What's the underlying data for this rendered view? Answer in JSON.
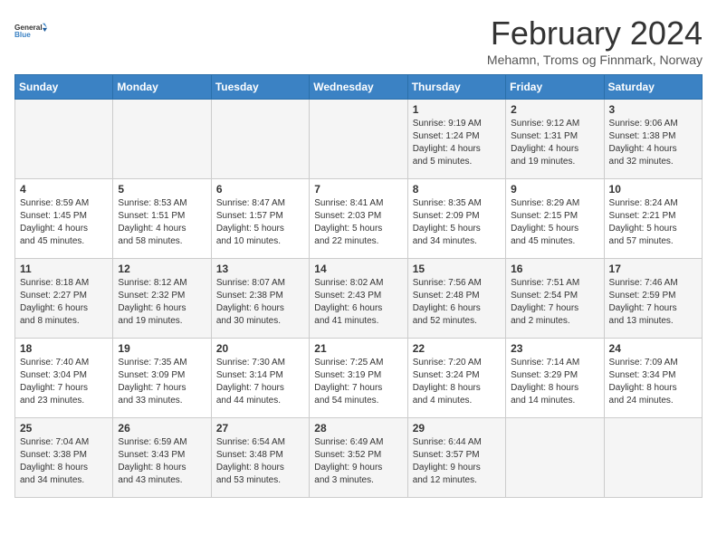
{
  "logo": {
    "line1": "General",
    "line2": "Blue"
  },
  "title": "February 2024",
  "subtitle": "Mehamn, Troms og Finnmark, Norway",
  "days_header": [
    "Sunday",
    "Monday",
    "Tuesday",
    "Wednesday",
    "Thursday",
    "Friday",
    "Saturday"
  ],
  "weeks": [
    [
      {
        "day": "",
        "info": ""
      },
      {
        "day": "",
        "info": ""
      },
      {
        "day": "",
        "info": ""
      },
      {
        "day": "",
        "info": ""
      },
      {
        "day": "1",
        "info": "Sunrise: 9:19 AM\nSunset: 1:24 PM\nDaylight: 4 hours\nand 5 minutes."
      },
      {
        "day": "2",
        "info": "Sunrise: 9:12 AM\nSunset: 1:31 PM\nDaylight: 4 hours\nand 19 minutes."
      },
      {
        "day": "3",
        "info": "Sunrise: 9:06 AM\nSunset: 1:38 PM\nDaylight: 4 hours\nand 32 minutes."
      }
    ],
    [
      {
        "day": "4",
        "info": "Sunrise: 8:59 AM\nSunset: 1:45 PM\nDaylight: 4 hours\nand 45 minutes."
      },
      {
        "day": "5",
        "info": "Sunrise: 8:53 AM\nSunset: 1:51 PM\nDaylight: 4 hours\nand 58 minutes."
      },
      {
        "day": "6",
        "info": "Sunrise: 8:47 AM\nSunset: 1:57 PM\nDaylight: 5 hours\nand 10 minutes."
      },
      {
        "day": "7",
        "info": "Sunrise: 8:41 AM\nSunset: 2:03 PM\nDaylight: 5 hours\nand 22 minutes."
      },
      {
        "day": "8",
        "info": "Sunrise: 8:35 AM\nSunset: 2:09 PM\nDaylight: 5 hours\nand 34 minutes."
      },
      {
        "day": "9",
        "info": "Sunrise: 8:29 AM\nSunset: 2:15 PM\nDaylight: 5 hours\nand 45 minutes."
      },
      {
        "day": "10",
        "info": "Sunrise: 8:24 AM\nSunset: 2:21 PM\nDaylight: 5 hours\nand 57 minutes."
      }
    ],
    [
      {
        "day": "11",
        "info": "Sunrise: 8:18 AM\nSunset: 2:27 PM\nDaylight: 6 hours\nand 8 minutes."
      },
      {
        "day": "12",
        "info": "Sunrise: 8:12 AM\nSunset: 2:32 PM\nDaylight: 6 hours\nand 19 minutes."
      },
      {
        "day": "13",
        "info": "Sunrise: 8:07 AM\nSunset: 2:38 PM\nDaylight: 6 hours\nand 30 minutes."
      },
      {
        "day": "14",
        "info": "Sunrise: 8:02 AM\nSunset: 2:43 PM\nDaylight: 6 hours\nand 41 minutes."
      },
      {
        "day": "15",
        "info": "Sunrise: 7:56 AM\nSunset: 2:48 PM\nDaylight: 6 hours\nand 52 minutes."
      },
      {
        "day": "16",
        "info": "Sunrise: 7:51 AM\nSunset: 2:54 PM\nDaylight: 7 hours\nand 2 minutes."
      },
      {
        "day": "17",
        "info": "Sunrise: 7:46 AM\nSunset: 2:59 PM\nDaylight: 7 hours\nand 13 minutes."
      }
    ],
    [
      {
        "day": "18",
        "info": "Sunrise: 7:40 AM\nSunset: 3:04 PM\nDaylight: 7 hours\nand 23 minutes."
      },
      {
        "day": "19",
        "info": "Sunrise: 7:35 AM\nSunset: 3:09 PM\nDaylight: 7 hours\nand 33 minutes."
      },
      {
        "day": "20",
        "info": "Sunrise: 7:30 AM\nSunset: 3:14 PM\nDaylight: 7 hours\nand 44 minutes."
      },
      {
        "day": "21",
        "info": "Sunrise: 7:25 AM\nSunset: 3:19 PM\nDaylight: 7 hours\nand 54 minutes."
      },
      {
        "day": "22",
        "info": "Sunrise: 7:20 AM\nSunset: 3:24 PM\nDaylight: 8 hours\nand 4 minutes."
      },
      {
        "day": "23",
        "info": "Sunrise: 7:14 AM\nSunset: 3:29 PM\nDaylight: 8 hours\nand 14 minutes."
      },
      {
        "day": "24",
        "info": "Sunrise: 7:09 AM\nSunset: 3:34 PM\nDaylight: 8 hours\nand 24 minutes."
      }
    ],
    [
      {
        "day": "25",
        "info": "Sunrise: 7:04 AM\nSunset: 3:38 PM\nDaylight: 8 hours\nand 34 minutes."
      },
      {
        "day": "26",
        "info": "Sunrise: 6:59 AM\nSunset: 3:43 PM\nDaylight: 8 hours\nand 43 minutes."
      },
      {
        "day": "27",
        "info": "Sunrise: 6:54 AM\nSunset: 3:48 PM\nDaylight: 8 hours\nand 53 minutes."
      },
      {
        "day": "28",
        "info": "Sunrise: 6:49 AM\nSunset: 3:52 PM\nDaylight: 9 hours\nand 3 minutes."
      },
      {
        "day": "29",
        "info": "Sunrise: 6:44 AM\nSunset: 3:57 PM\nDaylight: 9 hours\nand 12 minutes."
      },
      {
        "day": "",
        "info": ""
      },
      {
        "day": "",
        "info": ""
      }
    ]
  ]
}
